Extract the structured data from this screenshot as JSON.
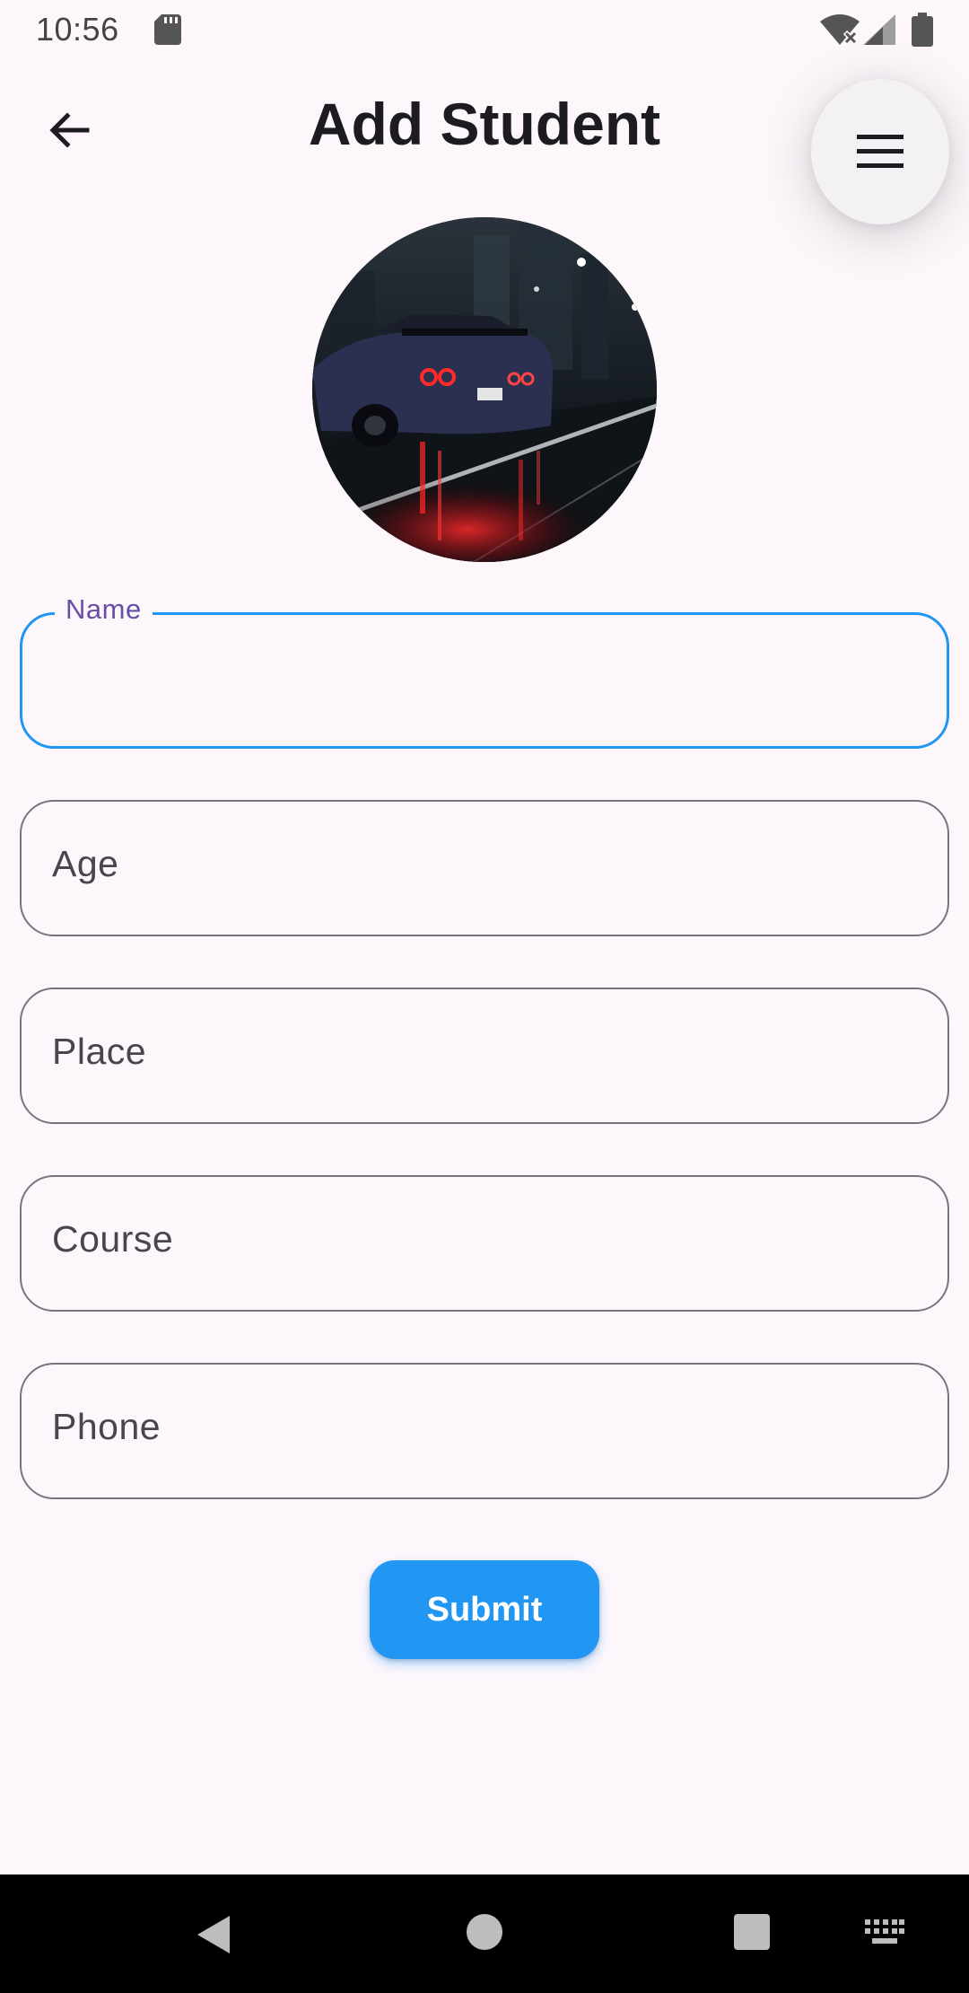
{
  "status_bar": {
    "time": "10:56",
    "icons": [
      "sd-card-icon",
      "wifi-off-icon",
      "signal-icon",
      "battery-icon"
    ]
  },
  "app_bar": {
    "title": "Add Student",
    "back_icon": "arrow-back-icon",
    "menu_icon": "menu-icon"
  },
  "avatar": {
    "description": "profile-photo"
  },
  "form": {
    "name": {
      "label": "Name",
      "value": ""
    },
    "age": {
      "label": "Age",
      "value": ""
    },
    "place": {
      "label": "Place",
      "value": ""
    },
    "course": {
      "label": "Course",
      "value": ""
    },
    "phone": {
      "label": "Phone",
      "value": ""
    }
  },
  "submit_label": "Submit",
  "colors": {
    "background": "#fdf7fc",
    "accent": "#2196f3",
    "label_focus": "#6750a4",
    "outline": "#79747e"
  },
  "nav_bar": {
    "icons": [
      "nav-back-icon",
      "nav-home-icon",
      "nav-recents-icon",
      "keyboard-icon"
    ]
  }
}
